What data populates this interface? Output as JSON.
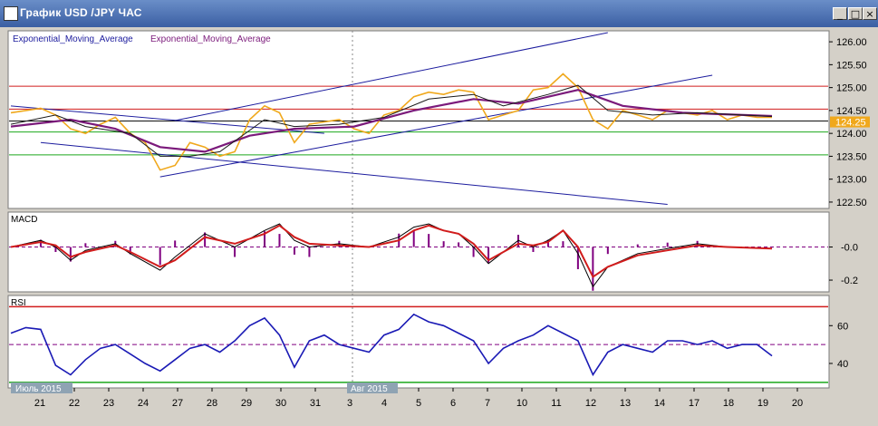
{
  "window": {
    "title": "График USD /JPY  ЧАС",
    "minimize_glyph": "_",
    "maximize_glyph": "□",
    "close_glyph": "×"
  },
  "colors": {
    "price": "#f0a81c",
    "ema_fast": "#1a1a1a",
    "ema_slow": "#7b1a7b",
    "channel": "#1c1c9e",
    "resistance": "#d11c1c",
    "support": "#1ca81c",
    "pivot": "#111111",
    "macd_signal": "#d11c1c",
    "histogram": "#800080",
    "rsi": "#1a1ab5",
    "rsi_mid": "#800080",
    "tag_bg": "#8fa3b3"
  },
  "chart_data": [
    {
      "type": "line",
      "panel": "price",
      "legend": [
        "Exponential_Moving_Average",
        "Exponential_Moving_Average"
      ],
      "ylim": [
        122.4,
        126.2
      ],
      "y_ticks": [
        "126.00",
        "125.50",
        "125.00",
        "124.50",
        "124.00",
        "123.50",
        "123.00",
        "122.50"
      ],
      "last_price_label": "124.25",
      "horizontal_lines": [
        {
          "name": "resistance-upper",
          "value": 125.03,
          "color": "#d11c1c"
        },
        {
          "name": "resistance-lower",
          "value": 124.53,
          "color": "#d11c1c"
        },
        {
          "name": "pivot",
          "value": 124.27,
          "color": "#111111"
        },
        {
          "name": "support-upper",
          "value": 124.03,
          "color": "#1ca81c"
        },
        {
          "name": "support-lower",
          "value": 123.53,
          "color": "#1ca81c"
        }
      ],
      "trend_lines": [
        {
          "name": "channel-down-upper",
          "points": [
            [
              0,
              124.6
            ],
            [
              21,
              124.0
            ]
          ]
        },
        {
          "name": "channel-down-lower",
          "points": [
            [
              2,
              123.8
            ],
            [
              44,
              122.45
            ]
          ]
        },
        {
          "name": "channel-up-upper",
          "points": [
            [
              11,
              124.28
            ],
            [
              40,
              126.2
            ]
          ]
        },
        {
          "name": "channel-up-lower",
          "points": [
            [
              10,
              123.05
            ],
            [
              47,
              125.27
            ]
          ]
        }
      ],
      "price": [
        [
          0,
          124.45
        ],
        [
          1,
          124.5
        ],
        [
          2,
          124.55
        ],
        [
          3,
          124.4
        ],
        [
          4,
          124.1
        ],
        [
          5,
          124.0
        ],
        [
          6,
          124.2
        ],
        [
          7,
          124.35
        ],
        [
          8,
          124.0
        ],
        [
          9,
          123.8
        ],
        [
          10,
          123.2
        ],
        [
          11,
          123.3
        ],
        [
          12,
          123.8
        ],
        [
          13,
          123.7
        ],
        [
          14,
          123.5
        ],
        [
          15,
          123.6
        ],
        [
          16,
          124.3
        ],
        [
          17,
          124.6
        ],
        [
          18,
          124.45
        ],
        [
          19,
          123.8
        ],
        [
          20,
          124.2
        ],
        [
          21,
          124.25
        ],
        [
          22,
          124.3
        ],
        [
          23,
          124.1
        ],
        [
          24,
          124.0
        ],
        [
          25,
          124.4
        ],
        [
          26,
          124.5
        ],
        [
          27,
          124.8
        ],
        [
          28,
          124.9
        ],
        [
          29,
          124.85
        ],
        [
          30,
          124.95
        ],
        [
          31,
          124.9
        ],
        [
          32,
          124.3
        ],
        [
          33,
          124.4
        ],
        [
          34,
          124.5
        ],
        [
          35,
          124.95
        ],
        [
          36,
          125.0
        ],
        [
          37,
          125.3
        ],
        [
          38,
          125.0
        ],
        [
          39,
          124.3
        ],
        [
          40,
          124.1
        ],
        [
          41,
          124.5
        ],
        [
          42,
          124.4
        ],
        [
          43,
          124.3
        ],
        [
          44,
          124.5
        ],
        [
          45,
          124.45
        ],
        [
          46,
          124.4
        ],
        [
          47,
          124.5
        ],
        [
          48,
          124.3
        ],
        [
          49,
          124.4
        ],
        [
          50,
          124.35
        ],
        [
          51,
          124.35
        ]
      ],
      "ema_fast": [
        [
          0,
          124.2
        ],
        [
          3,
          124.4
        ],
        [
          5,
          124.15
        ],
        [
          8,
          124.0
        ],
        [
          10,
          123.5
        ],
        [
          12,
          123.5
        ],
        [
          14,
          123.6
        ],
        [
          17,
          124.3
        ],
        [
          19,
          124.15
        ],
        [
          22,
          124.2
        ],
        [
          25,
          124.35
        ],
        [
          28,
          124.75
        ],
        [
          31,
          124.85
        ],
        [
          33,
          124.6
        ],
        [
          36,
          124.85
        ],
        [
          38,
          125.05
        ],
        [
          40,
          124.5
        ],
        [
          43,
          124.4
        ],
        [
          46,
          124.45
        ],
        [
          51,
          124.37
        ]
      ],
      "ema_slow": [
        [
          0,
          124.15
        ],
        [
          4,
          124.3
        ],
        [
          7,
          124.1
        ],
        [
          10,
          123.7
        ],
        [
          13,
          123.6
        ],
        [
          16,
          123.95
        ],
        [
          19,
          124.1
        ],
        [
          23,
          124.15
        ],
        [
          27,
          124.5
        ],
        [
          31,
          124.75
        ],
        [
          34,
          124.65
        ],
        [
          38,
          124.95
        ],
        [
          41,
          124.6
        ],
        [
          45,
          124.45
        ],
        [
          51,
          124.38
        ]
      ]
    },
    {
      "type": "line",
      "panel": "macd",
      "title": "MACD",
      "ylim": [
        -0.26,
        0.2
      ],
      "y_ticks": [
        "-0.0",
        "-0.2"
      ],
      "macd": [
        [
          0,
          0.0
        ],
        [
          2,
          0.04
        ],
        [
          3,
          0.0
        ],
        [
          4,
          -0.08
        ],
        [
          5,
          -0.02
        ],
        [
          7,
          0.02
        ],
        [
          8,
          -0.04
        ],
        [
          10,
          -0.14
        ],
        [
          11,
          -0.06
        ],
        [
          13,
          0.08
        ],
        [
          15,
          0.0
        ],
        [
          17,
          0.1
        ],
        [
          18,
          0.14
        ],
        [
          19,
          0.04
        ],
        [
          20,
          0.0
        ],
        [
          22,
          0.02
        ],
        [
          24,
          0.0
        ],
        [
          26,
          0.06
        ],
        [
          27,
          0.12
        ],
        [
          28,
          0.14
        ],
        [
          29,
          0.1
        ],
        [
          30,
          0.08
        ],
        [
          31,
          0.0
        ],
        [
          32,
          -0.1
        ],
        [
          34,
          0.04
        ],
        [
          35,
          0.0
        ],
        [
          36,
          0.04
        ],
        [
          37,
          0.1
        ],
        [
          38,
          -0.04
        ],
        [
          39,
          -0.24
        ],
        [
          40,
          -0.12
        ],
        [
          42,
          -0.04
        ],
        [
          44,
          -0.01
        ],
        [
          46,
          0.02
        ],
        [
          48,
          0.0
        ],
        [
          51,
          -0.01
        ]
      ],
      "signal": [
        [
          0,
          0.0
        ],
        [
          2,
          0.03
        ],
        [
          3,
          0.01
        ],
        [
          4,
          -0.06
        ],
        [
          5,
          -0.03
        ],
        [
          7,
          0.01
        ],
        [
          8,
          -0.03
        ],
        [
          10,
          -0.12
        ],
        [
          11,
          -0.08
        ],
        [
          13,
          0.06
        ],
        [
          15,
          0.02
        ],
        [
          17,
          0.08
        ],
        [
          18,
          0.13
        ],
        [
          19,
          0.06
        ],
        [
          20,
          0.02
        ],
        [
          22,
          0.01
        ],
        [
          24,
          0.0
        ],
        [
          26,
          0.04
        ],
        [
          27,
          0.1
        ],
        [
          28,
          0.13
        ],
        [
          29,
          0.1
        ],
        [
          30,
          0.08
        ],
        [
          31,
          0.02
        ],
        [
          32,
          -0.08
        ],
        [
          34,
          0.02
        ],
        [
          35,
          0.01
        ],
        [
          36,
          0.03
        ],
        [
          37,
          0.1
        ],
        [
          38,
          0.0
        ],
        [
          39,
          -0.18
        ],
        [
          40,
          -0.12
        ],
        [
          42,
          -0.05
        ],
        [
          44,
          -0.02
        ],
        [
          46,
          0.01
        ],
        [
          48,
          0.0
        ],
        [
          51,
          -0.01
        ]
      ]
    },
    {
      "type": "line",
      "panel": "rsi",
      "title": "RSI",
      "ylim": [
        28,
        75
      ],
      "y_ticks": [
        "60",
        "40"
      ],
      "overbought": 70,
      "midline": 50,
      "oversold": 30,
      "rsi": [
        [
          0,
          56
        ],
        [
          1,
          59
        ],
        [
          2,
          58
        ],
        [
          3,
          39
        ],
        [
          4,
          34
        ],
        [
          5,
          42
        ],
        [
          6,
          48
        ],
        [
          7,
          50
        ],
        [
          8,
          45
        ],
        [
          9,
          40
        ],
        [
          10,
          36
        ],
        [
          11,
          42
        ],
        [
          12,
          48
        ],
        [
          13,
          50
        ],
        [
          14,
          46
        ],
        [
          15,
          52
        ],
        [
          16,
          60
        ],
        [
          17,
          64
        ],
        [
          18,
          55
        ],
        [
          19,
          38
        ],
        [
          20,
          52
        ],
        [
          21,
          55
        ],
        [
          22,
          50
        ],
        [
          23,
          48
        ],
        [
          24,
          46
        ],
        [
          25,
          55
        ],
        [
          26,
          58
        ],
        [
          27,
          66
        ],
        [
          28,
          62
        ],
        [
          29,
          60
        ],
        [
          30,
          56
        ],
        [
          31,
          52
        ],
        [
          32,
          40
        ],
        [
          33,
          48
        ],
        [
          34,
          52
        ],
        [
          35,
          55
        ],
        [
          36,
          60
        ],
        [
          37,
          56
        ],
        [
          38,
          52
        ],
        [
          39,
          34
        ],
        [
          40,
          46
        ],
        [
          41,
          50
        ],
        [
          42,
          48
        ],
        [
          43,
          46
        ],
        [
          44,
          52
        ],
        [
          45,
          52
        ],
        [
          46,
          50
        ],
        [
          47,
          52
        ],
        [
          48,
          48
        ],
        [
          49,
          50
        ],
        [
          50,
          50
        ],
        [
          51,
          44
        ]
      ]
    }
  ],
  "time_axis": {
    "labels": [
      "21",
      "22",
      "23",
      "24",
      "27",
      "28",
      "29",
      "30",
      "31",
      "3",
      "4",
      "5",
      "6",
      "7",
      "10",
      "11",
      "12",
      "13",
      "14",
      "17",
      "18",
      "19",
      "20"
    ],
    "month_tags": [
      "Июль 2015",
      "Авг 2015"
    ]
  }
}
